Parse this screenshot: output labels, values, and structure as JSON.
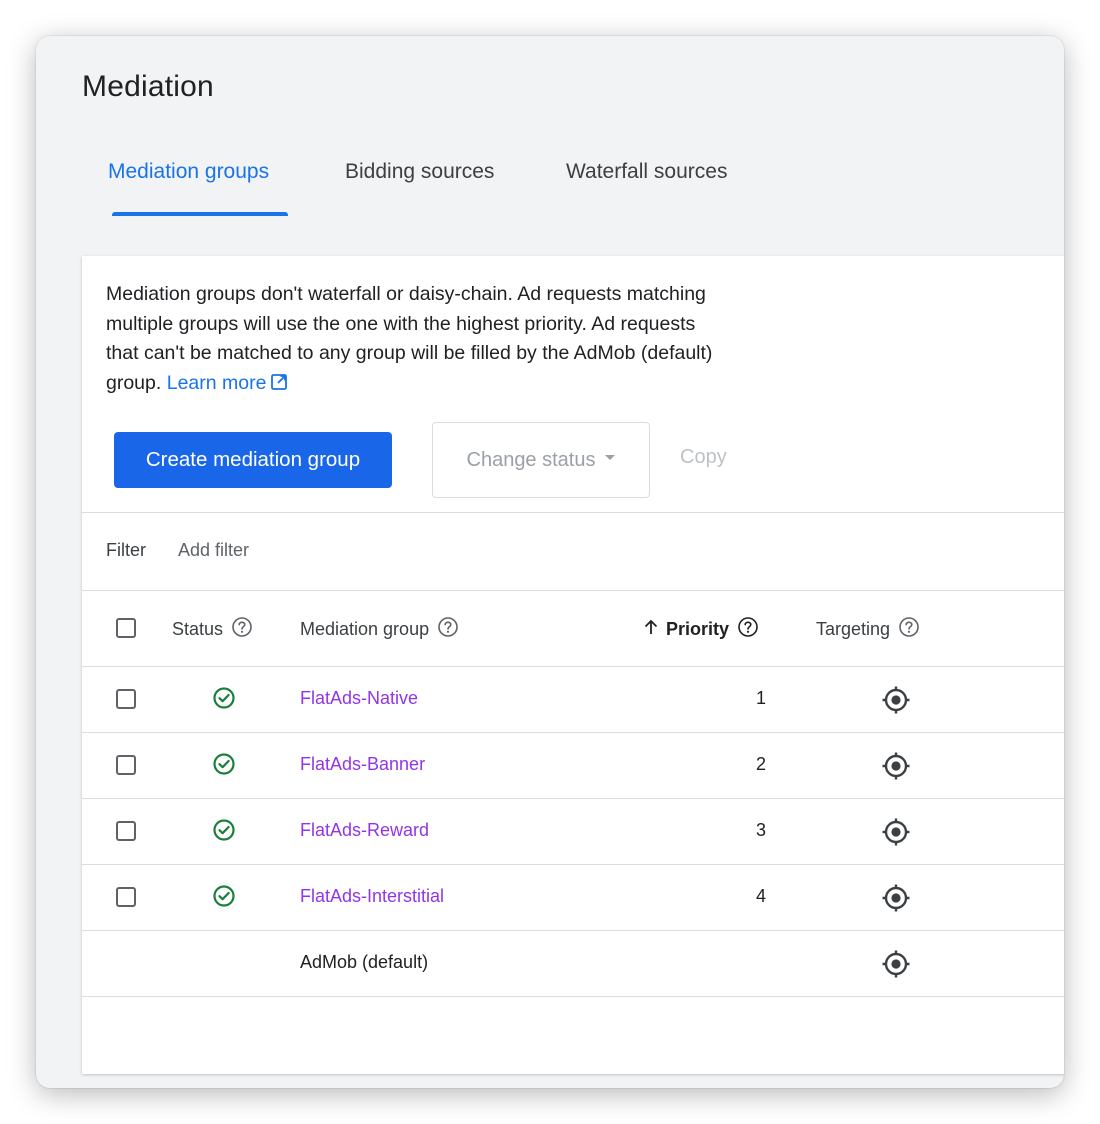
{
  "page": {
    "title": "Mediation"
  },
  "tabs": [
    {
      "label": "Mediation groups",
      "active": true
    },
    {
      "label": "Bidding sources",
      "active": false
    },
    {
      "label": "Waterfall sources",
      "active": false
    }
  ],
  "info": {
    "line1": "Mediation groups don't waterfall or daisy-chain. Ad requests matching",
    "line2": "multiple groups will use the one with the highest priority. Ad requests",
    "line3": "that can't be matched to any group will be filled by the AdMob (default)",
    "line4": "group.",
    "learn_more": "Learn more"
  },
  "toolbar": {
    "create_label": "Create mediation group",
    "change_status_label": "Change status",
    "copy_label": "Copy"
  },
  "filter": {
    "label": "Filter",
    "add_label": "Add filter"
  },
  "table": {
    "headers": {
      "status": "Status",
      "group": "Mediation group",
      "priority": "Priority",
      "targeting": "Targeting"
    },
    "sort": {
      "column": "Priority",
      "direction": "ascending"
    },
    "rows": [
      {
        "name": "FlatAds-Native",
        "priority": "1",
        "status": "enabled",
        "selectable": true
      },
      {
        "name": "FlatAds-Banner",
        "priority": "2",
        "status": "enabled",
        "selectable": true
      },
      {
        "name": "FlatAds-Reward",
        "priority": "3",
        "status": "enabled",
        "selectable": true
      },
      {
        "name": "FlatAds-Interstitial",
        "priority": "4",
        "status": "enabled",
        "selectable": true
      },
      {
        "name": "AdMob (default)",
        "priority": "",
        "status": "",
        "selectable": false
      }
    ]
  },
  "icons": {
    "status_enabled": "check-circle-icon",
    "targeting": "target-icon",
    "help": "help-circle-icon",
    "external_link": "open-in-new-icon",
    "sort": "arrow-up-icon"
  },
  "colors": {
    "accent": "#1a73e8",
    "link_purple": "#9334e6",
    "status_green": "#188038"
  }
}
